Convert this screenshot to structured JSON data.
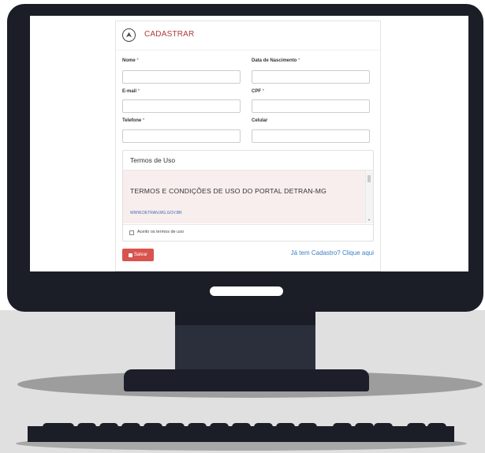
{
  "card": {
    "title": "CADASTRAR"
  },
  "form": {
    "required_mark": "*",
    "nome_label": "Nome",
    "nascimento_label": "Data de Nascimento",
    "email_label": "E-mail",
    "cpf_label": "CPF",
    "telefone_label": "Telefone",
    "celular_label": "Celular"
  },
  "terms": {
    "title": "Termos de Uso",
    "heading": "TERMOS E CONDIÇÕES DE USO DO PORTAL DETRAN-MG",
    "link": "WWW.DETRAN.MG.GOV.BR",
    "accept_label": "Aceito os termos de uso"
  },
  "actions": {
    "save_label": "Salvar",
    "login_link": "Já tem Cadastro? Clique aqui"
  },
  "colors": {
    "accent": "#d9534f",
    "title": "#b23a3a",
    "link": "#3c7ec7"
  }
}
